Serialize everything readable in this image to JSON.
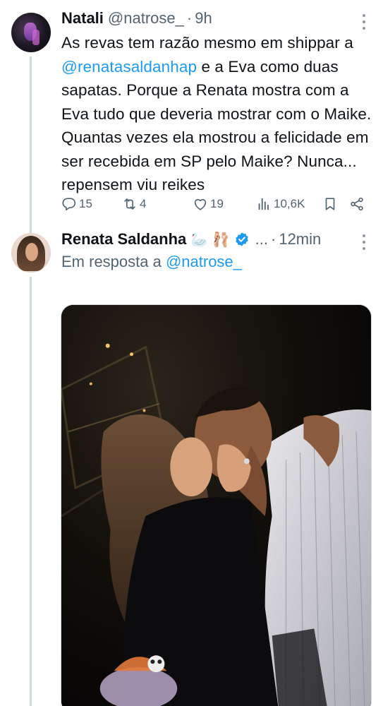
{
  "tweet1": {
    "display_name": "Natali",
    "handle": "@natrose_",
    "dot": "·",
    "time": "9h",
    "text_parts": [
      "As revas tem razão mesmo em shippar a ",
      "@renatasaldanhap",
      " e a Eva como duas sapatas. Porque a Renata mostra com a Eva tudo que deveria mostrar com o Maike. Quantas vezes ela mostrou a felicidade em ser recebida em SP pelo Maike? Nunca... repensem viu reikes"
    ],
    "replies": "15",
    "reposts": "4",
    "likes": "19",
    "views": "10,6K"
  },
  "tweet2": {
    "display_name": "Renata Saldanha",
    "emojis": "🦢 🩰",
    "ellipsis": "...",
    "dot": "·",
    "time": "12min",
    "reply_prefix": "Em resposta a ",
    "reply_handle": "@natrose_"
  },
  "icons": {
    "reply": "reply-icon",
    "repost": "repost-icon",
    "like": "heart-icon",
    "views": "views-icon",
    "bookmark": "bookmark-icon",
    "share": "share-icon",
    "verified": "verified-badge-icon",
    "more": "more-options-icon"
  },
  "colors": {
    "accent": "#1d9bf0",
    "secondary_text": "#536471",
    "primary_text": "#0f1419",
    "thread_line": "#cfd9de"
  }
}
